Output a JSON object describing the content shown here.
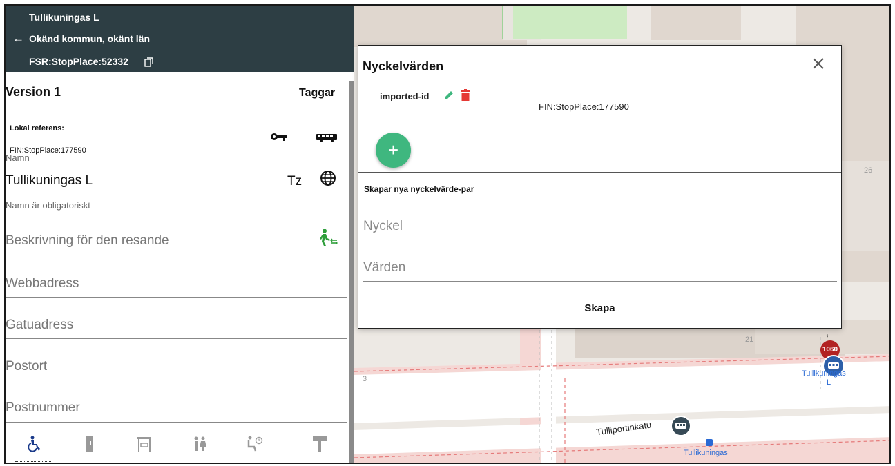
{
  "header": {
    "stop_name": "Tullikuningas L",
    "location": "Okänd kommun, okänt län",
    "stop_id": "FSR:StopPlace:52332"
  },
  "form": {
    "version": "Version 1",
    "tags_label": "Taggar",
    "local_ref_label": "Lokal referens:",
    "local_ref_value": "FIN:StopPlace:177590",
    "name_label": "Namn",
    "name_value": "Tullikuningas L",
    "timezone_label": "Tz",
    "name_required": "Namn är obligatoriskt",
    "description_placeholder": "Beskrivning för den resande",
    "url_placeholder": "Webbadress",
    "street_placeholder": "Gatuadress",
    "city_placeholder": "Postort",
    "postal_placeholder": "Postnummer"
  },
  "tabs": [
    {
      "icon": "wheelchair-icon",
      "active": true
    },
    {
      "icon": "ticket-machine-icon",
      "active": false
    },
    {
      "icon": "shelter-icon",
      "active": false
    },
    {
      "icon": "restroom-icon",
      "active": false
    },
    {
      "icon": "waiting-room-icon",
      "active": false
    },
    {
      "icon": "sign-icon",
      "active": false
    }
  ],
  "dialog": {
    "title": "Nyckelvärden",
    "pairs": [
      {
        "key": "imported-id",
        "value": "FIN:StopPlace:177590"
      }
    ],
    "add_label": "+",
    "new_pair_title": "Skapar nya nyckelvärde-par",
    "key_placeholder": "Nyckel",
    "value_placeholder": "Värden",
    "create_label": "Skapa"
  },
  "map": {
    "house_number_26": "26",
    "house_number_21": "21",
    "house_number_3": "3",
    "stop_label": "Tullikuningas",
    "stop_label_suffix": "L",
    "street_label": "Tulliportinkatu",
    "route_badge": "1060",
    "stop_label_2": "Tullikuningas"
  },
  "colors": {
    "header_bg": "#2d3e44",
    "fab": "#3fb77f",
    "pencil": "#3fb77f",
    "trash": "#e53935",
    "walk_icon": "#2e9e3a",
    "route_badge": "#b22222",
    "stop_badge": "#2d5fa8"
  }
}
